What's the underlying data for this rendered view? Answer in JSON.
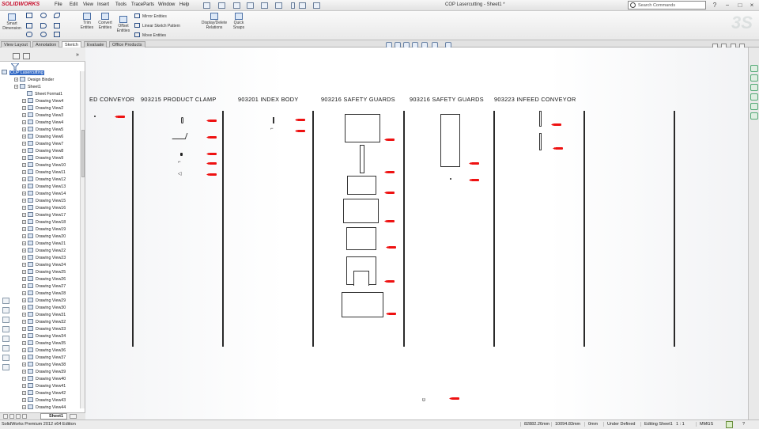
{
  "app": {
    "logo": "SOLIDWORKS",
    "menu": [
      "File",
      "Edit",
      "View",
      "Insert",
      "Tools",
      "TraceParts",
      "Window",
      "Help"
    ],
    "document_title": "COP Lasercutting - Sheet1 *",
    "search_placeholder": "Search Commands",
    "window_controls": [
      "?",
      "−",
      "□",
      "×"
    ]
  },
  "ribbon": {
    "smart_dimension": "Smart Dimension",
    "trim_entities": "Trim Entities",
    "convert_entities": "Convert Entities",
    "offset_entities": "Offset Entities",
    "mirror_entities": "Mirror Entities",
    "linear_sketch_pattern": "Linear Sketch Pattern",
    "move_entities": "Move Entities",
    "display_delete_relations": "Display/Delete Relations",
    "quick_snaps": "Quick Snaps"
  },
  "tabs": [
    "View Layout",
    "Annotation",
    "Sketch",
    "Evaluate",
    "Office Products"
  ],
  "active_tab": "Sketch",
  "tree": {
    "root": "COP Lasercutting",
    "design_binder": "Design Binder",
    "sheet": "Sheet1",
    "sheet_format": "Sheet Format1",
    "views": [
      "Drawing View4",
      "Drawing View2",
      "Drawing View3",
      "Drawing View4",
      "Drawing View5",
      "Drawing View6",
      "Drawing View7",
      "Drawing View8",
      "Drawing View9",
      "Drawing View10",
      "Drawing View11",
      "Drawing View12",
      "Drawing View13",
      "Drawing View14",
      "Drawing View15",
      "Drawing View16",
      "Drawing View17",
      "Drawing View18",
      "Drawing View19",
      "Drawing View20",
      "Drawing View21",
      "Drawing View22",
      "Drawing View23",
      "Drawing View24",
      "Drawing View25",
      "Drawing View26",
      "Drawing View27",
      "Drawing View28",
      "Drawing View29",
      "Drawing View30",
      "Drawing View31",
      "Drawing View32",
      "Drawing View33",
      "Drawing View34",
      "Drawing View35",
      "Drawing View36",
      "Drawing View37",
      "Drawing View38",
      "Drawing View39",
      "Drawing View40",
      "Drawing View41",
      "Drawing View42",
      "Drawing View43",
      "Drawing View44"
    ]
  },
  "sheet_tab": "Sheet1",
  "canvas": {
    "sections": [
      "ED CONVEYOR",
      "903215 PRODUCT CLAMP",
      "903201 INDEX BODY",
      "903216 SAFETY GUARDS",
      "903216 SAFETY GUARDS",
      "903223 INFEED CONVEYOR"
    ]
  },
  "status": {
    "edition": "SolidWorks Premium 2012 x64 Edition",
    "x": "82882.26mm",
    "y": "10094.83mm",
    "z": "0mm",
    "definition": "Under Defined",
    "editing": "Editing Sheet1",
    "scale": "1 : 1",
    "units": "MMGS",
    "help": "?"
  },
  "colors": {
    "accent_red": "#e11111",
    "selection_blue": "#3168c4"
  },
  "icons": [
    "sw-logo-icon",
    "search-icon",
    "smart-dimension-icon",
    "line-icon",
    "circle-icon",
    "spline-icon",
    "rectangle-icon",
    "arc-icon",
    "trim-entities-icon",
    "convert-entities-icon",
    "offset-entities-icon",
    "mirror-entities-icon",
    "linear-pattern-icon",
    "move-entities-icon",
    "display-relations-icon",
    "quick-snaps-icon",
    "zoom-fit-icon",
    "zoom-area-icon",
    "previous-view-icon",
    "section-view-icon",
    "view-orientation-icon",
    "display-style-icon",
    "filter-icon",
    "feature-tree-icon",
    "property-manager-icon",
    "drawing-view-icon",
    "sheet-icon",
    "rebuild-icon"
  ]
}
